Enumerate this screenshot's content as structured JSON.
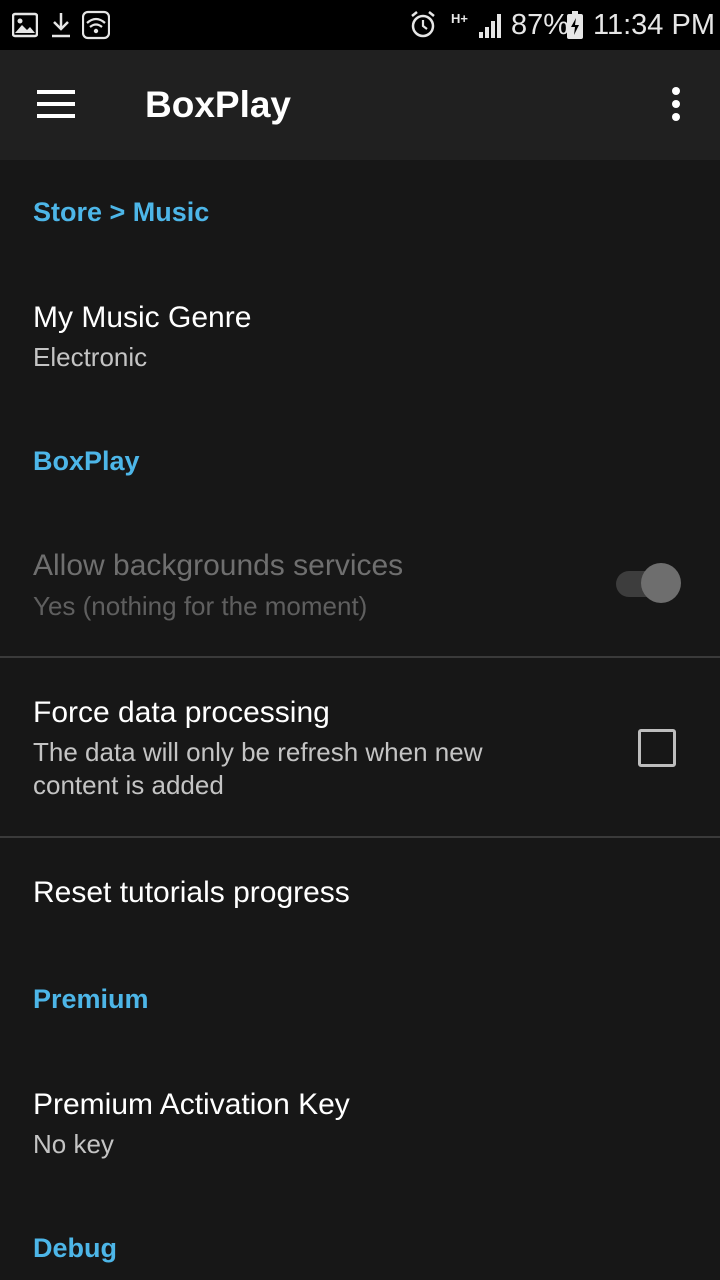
{
  "status_bar": {
    "battery": "87%",
    "time": "11:34 PM",
    "network_label": "H+",
    "icons": [
      "image-icon",
      "download-icon",
      "wifi-icon",
      "alarm-icon",
      "network-type-icon",
      "signal-icon",
      "battery-charging-icon"
    ]
  },
  "app_bar": {
    "title": "BoxPlay",
    "menu_icon": "hamburger-menu-icon",
    "overflow_icon": "more-vert-icon"
  },
  "sections": {
    "store_music": {
      "header": "Store > Music"
    },
    "music_genre": {
      "title": "My Music Genre",
      "summary": "Electronic"
    },
    "boxplay": {
      "header": "BoxPlay"
    },
    "background_services": {
      "title": "Allow backgrounds services",
      "summary": "Yes (nothing for the moment)",
      "enabled": false,
      "checked": true
    },
    "force_data": {
      "title": "Force data processing",
      "summary": "The data will only be refresh when new content is added",
      "checked": false
    },
    "reset_tutorials": {
      "title": "Reset tutorials progress"
    },
    "premium": {
      "header": "Premium"
    },
    "activation_key": {
      "title": "Premium Activation Key",
      "summary": "No key"
    },
    "debug": {
      "header": "Debug"
    }
  },
  "colors": {
    "accent": "#4db6e8",
    "background": "#171717",
    "app_bar": "#202020",
    "status_bar": "#000000"
  }
}
